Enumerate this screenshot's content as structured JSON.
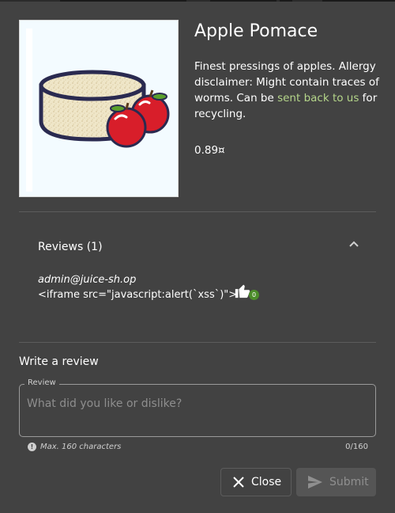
{
  "product": {
    "name": "Apple Pomace",
    "description_before_link": "Finest pressings of apples. Allergy disclaimer: Might contain traces of worms. Can be ",
    "description_link": "sent back to us",
    "description_after_link": " for recycling.",
    "price": "0.89¤",
    "image_icon": "apple-pomace-bowl-illustration"
  },
  "reviews": {
    "header": "Reviews (1)",
    "expanded": true,
    "items": [
      {
        "author": "admin@juice-sh.op",
        "text": "<iframe src=\"javascript:alert(`xss`)\">",
        "likes": "0"
      }
    ]
  },
  "write_review": {
    "title": "Write a review",
    "field_label": "Review",
    "placeholder": "What did you like or dislike?",
    "value": "",
    "hint": "Max. 160 characters",
    "counter": "0/160"
  },
  "actions": {
    "close_label": "Close",
    "submit_label": "Submit",
    "submit_disabled": true
  },
  "colors": {
    "background": "#424242",
    "link": "#b5d68a",
    "like_badge": "#4c8c2a",
    "apple_red": "#d81e2a"
  }
}
